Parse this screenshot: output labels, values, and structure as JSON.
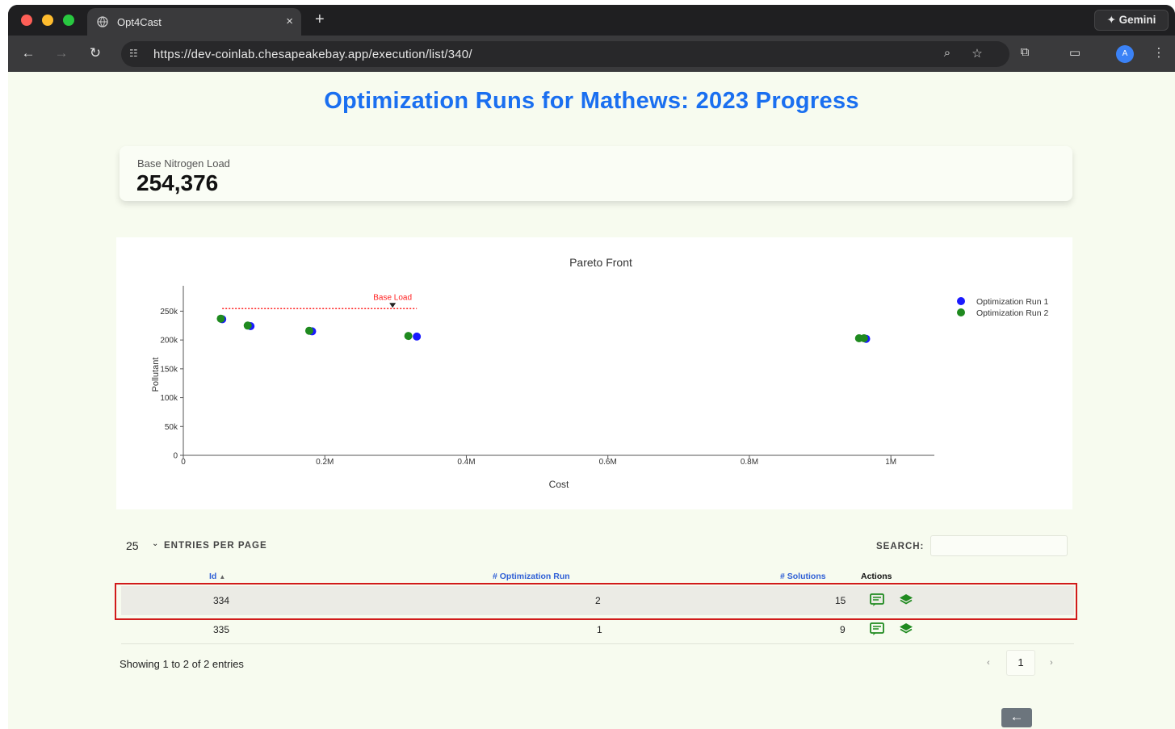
{
  "browser": {
    "tab_title": "Opt4Cast",
    "tab_close": "×",
    "new_tab": "+",
    "gemini_label": "Gemini",
    "url": "https://dev-coinlab.chesapeakebay.app/execution/list/340/",
    "profile_initial": "A"
  },
  "page": {
    "title": "Optimization Runs for Mathews: 2023 Progress",
    "stat": {
      "label": "Base Nitrogen Load",
      "value": "254,376"
    }
  },
  "chart_data": {
    "type": "scatter",
    "title": "Pareto Front",
    "xlabel": "Cost",
    "ylabel": "Pollutant",
    "xlim": [
      0,
      1050000
    ],
    "ylim": [
      0,
      280000
    ],
    "x_ticks": [
      0,
      200000,
      400000,
      600000,
      800000,
      1000000
    ],
    "x_tick_labels": [
      "0",
      "0.2M",
      "0.4M",
      "0.6M",
      "0.8M",
      "1M"
    ],
    "y_ticks": [
      0,
      50000,
      100000,
      150000,
      200000,
      250000
    ],
    "y_tick_labels": [
      "0",
      "50k",
      "100k",
      "150k",
      "200k",
      "250k"
    ],
    "legend_position": "top-right",
    "series": [
      {
        "name": "Optimization Run 1",
        "color": "#1a1aff",
        "points": [
          [
            55000,
            236000
          ],
          [
            95000,
            224000
          ],
          [
            182000,
            215000
          ],
          [
            330000,
            206000
          ],
          [
            965000,
            202000
          ]
        ]
      },
      {
        "name": "Optimization Run 2",
        "color": "#1f8a1f",
        "points": [
          [
            53000,
            237000
          ],
          [
            91000,
            225000
          ],
          [
            178000,
            216000
          ],
          [
            318000,
            207000
          ],
          [
            955000,
            203000
          ],
          [
            962000,
            203000
          ]
        ]
      }
    ],
    "annotation": {
      "label": "Base Load",
      "color": "#ff2020",
      "y": 254376,
      "x_range": [
        55000,
        330000
      ]
    }
  },
  "table": {
    "length_value": "25",
    "length_text": "ENTRIES PER PAGE",
    "search_label": "SEARCH:",
    "search_value": "",
    "columns": [
      "Id",
      "# Optimization Run",
      "# Solutions",
      "Actions"
    ],
    "rows": [
      {
        "id": "334",
        "run": "2",
        "solutions": "15"
      },
      {
        "id": "335",
        "run": "1",
        "solutions": "9"
      }
    ],
    "info": "Showing 1 to 2 of 2 entries",
    "pagination": {
      "prev": "‹",
      "current": "1",
      "next": "›"
    },
    "back_button": "←"
  },
  "icons": {
    "view": "view-solutions-icon",
    "layers": "layers-map-icon"
  }
}
